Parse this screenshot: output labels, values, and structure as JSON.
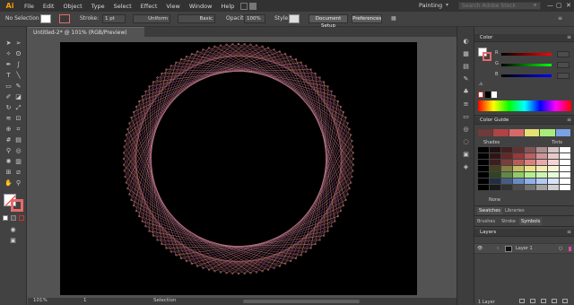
{
  "menubar": {
    "logo": "Ai",
    "items": [
      "File",
      "Edit",
      "Object",
      "Type",
      "Select",
      "Effect",
      "View",
      "Window",
      "Help"
    ],
    "workspace": "Painting",
    "search_placeholder": "Search Adobe Stock",
    "window_controls": [
      "—",
      "▢",
      "✕"
    ]
  },
  "controlbar": {
    "selection_label": "No Selection",
    "stroke_label": "Stroke:",
    "stroke_weight": "1 pt",
    "profile_label": "Uniform",
    "brush_label": "Basic",
    "opacity_label": "Opacity:",
    "opacity_value": "100%",
    "style_label": "Style:",
    "doc_setup_label": "Document Setup",
    "preferences_label": "Preferences"
  },
  "document": {
    "tab_title": "Untitled-2* @ 101% (RGB/Preview)",
    "close_glyph": "×"
  },
  "statusbar": {
    "zoom": "101%",
    "page": "1",
    "tool": "Selection"
  },
  "panels": {
    "color": {
      "title": "Color",
      "channels": [
        "R",
        "G",
        "B"
      ]
    },
    "color_guide": {
      "title": "Color Guide",
      "shades_label": "Shades",
      "tints_label": "Tints",
      "none_label": "None"
    },
    "tabs_row1": [
      "Swatches",
      "Libraries"
    ],
    "tabs_row2": [
      "Brushes",
      "Stroke",
      "Symbols"
    ],
    "layers": {
      "title": "Layers",
      "layer_name": "Layer 1",
      "count_label": "1 Layer"
    }
  },
  "colors": {
    "accent_logo": "#ff9a00",
    "artboard": "#000000",
    "art_inner": "#c4707a",
    "art_outer": "#f0a08a",
    "art_violet": "#8d5aa0",
    "guide_row": [
      "#6e3a3a",
      "#b04444",
      "#d66a6a",
      "#e6e074",
      "#a8ec7a",
      "#7aa2e6"
    ]
  },
  "art": {
    "description_points": 120,
    "inner_radius_ratio": 0.35,
    "outer_radius_ratio": 1.0
  }
}
